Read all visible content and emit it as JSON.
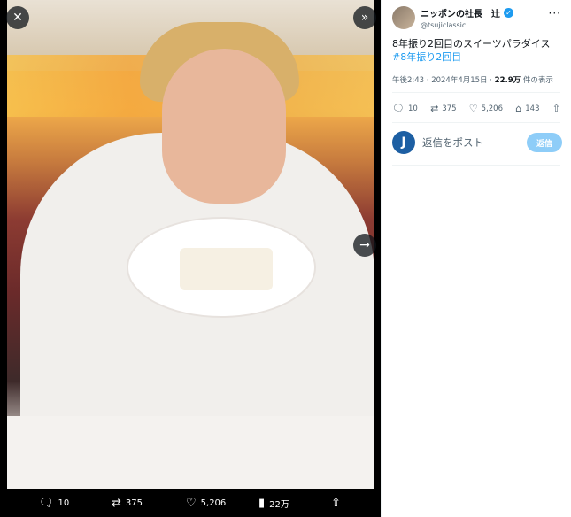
{
  "viewer": {
    "close_icon": "close-icon",
    "collapse_icon": "double-chevron-right-icon",
    "next_icon": "arrow-right-icon",
    "bottom_actions": {
      "replies": "10",
      "reposts": "375",
      "likes": "5,206",
      "views": "22万"
    }
  },
  "tweet": {
    "display_name": "ニッポンの社長　辻",
    "handle": "@tsujiclassic",
    "text": "8年振り2回目のスイーツパラダイス",
    "hashtag": "#8年振り2回目",
    "time": "午後2:43 · 2024年4月15日 · ",
    "views_count": "22.9万",
    "views_label": " 件の表示",
    "stats": {
      "replies": "10",
      "reposts": "375",
      "likes": "5,206",
      "bookmarks": "143"
    },
    "reply_placeholder": "返信をポスト",
    "reply_button": "返信",
    "reply_avatar_letter": "J"
  },
  "colors": {
    "accent": "#1d9bf0",
    "reply_button_disabled": "#8ecdf8",
    "secondary_text": "#536471"
  }
}
